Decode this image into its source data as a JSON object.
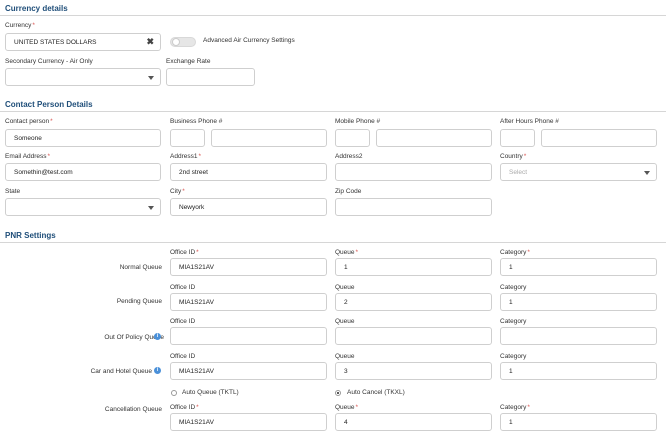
{
  "currency": {
    "section_title": "Currency details",
    "currency_label": "Currency",
    "currency_value": "UNITED STATES DOLLARS",
    "clear_symbol": "✖",
    "advanced_toggle_label": "Advanced Air Currency Settings",
    "advanced_toggle_on": false,
    "secondary_label": "Secondary Currency - Air Only",
    "secondary_value": "",
    "exchange_label": "Exchange Rate",
    "exchange_value": ""
  },
  "contact": {
    "section_title": "Contact Person Details",
    "contact_person_label": "Contact person",
    "contact_person_value": "Someone",
    "business_phone_label": "Business Phone #",
    "mobile_phone_label": "Mobile Phone #",
    "after_hours_label": "After Hours Phone #",
    "email_label": "Email Address",
    "email_value": "Somethin@test.com",
    "address1_label": "Address1",
    "address1_value": "2nd street",
    "address2_label": "Address2",
    "address2_value": "",
    "country_label": "Country",
    "country_placeholder": "Select",
    "state_label": "State",
    "state_value": "",
    "city_label": "City",
    "city_value": "Newyork",
    "zip_label": "Zip Code",
    "zip_value": ""
  },
  "pnr": {
    "section_title": "PNR Settings",
    "office_label": "Office ID",
    "queue_label": "Queue",
    "category_label": "Category",
    "rows": {
      "normal": {
        "label": "Normal Queue",
        "office": "MIA1S21AV",
        "queue": "1",
        "category": "1"
      },
      "pending": {
        "label": "Pending Queue",
        "office": "MIA1S21AV",
        "queue": "2",
        "category": "1"
      },
      "outofpolicy": {
        "label": "Out Of Policy Queue",
        "office": "",
        "queue": "",
        "category": ""
      },
      "carhotel": {
        "label": "Car and Hotel Queue",
        "office": "MIA1S21AV",
        "queue": "3",
        "category": "1"
      },
      "cancellation": {
        "label": "Cancellation Queue",
        "office": "MIA1S21AV",
        "queue": "4",
        "category": "1"
      }
    },
    "info_icon_glyph": "i",
    "radio_auto_queue": "Auto Queue (TKTL)",
    "radio_auto_cancel": "Auto Cancel (TKXL)",
    "radio_selected": "auto_cancel"
  }
}
